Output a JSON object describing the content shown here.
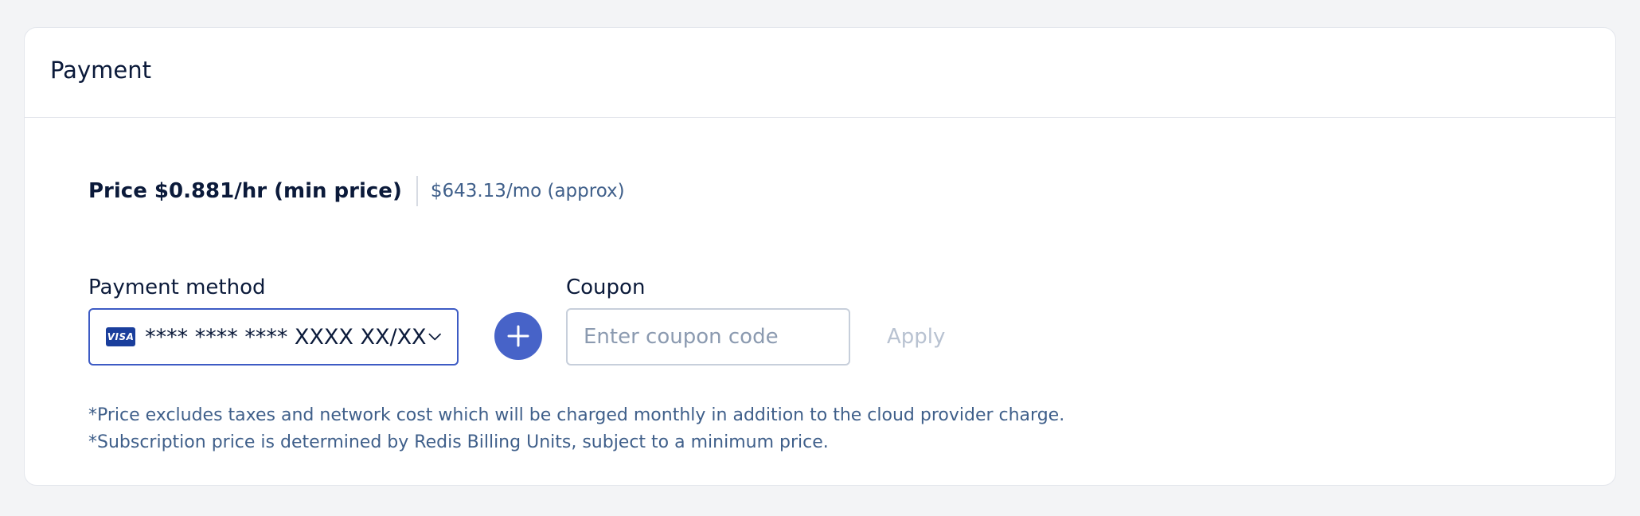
{
  "card": {
    "title": "Payment"
  },
  "price": {
    "main": "Price $0.881/hr (min price)",
    "monthly": "$643.13/mo (approx)"
  },
  "payment_method": {
    "label": "Payment method",
    "card_brand": "VISA",
    "card_value": "**** **** **** XXXX XX/XX",
    "icon": "chevron-down-icon"
  },
  "add_payment": {
    "icon": "plus-icon"
  },
  "coupon": {
    "label": "Coupon",
    "placeholder": "Enter coupon code",
    "value": "",
    "apply_label": "Apply"
  },
  "notes": [
    "*Price excludes taxes and network cost which will be charged monthly in addition to the cloud provider charge.",
    "*Subscription price is determined by Redis Billing Units, subject to a minimum price."
  ],
  "colors": {
    "accent": "#4763c8",
    "visa_blue": "#1a3e9c",
    "text_primary": "#0b1a3a",
    "text_secondary": "#3f5f8a",
    "disabled": "#b8c2d1"
  }
}
